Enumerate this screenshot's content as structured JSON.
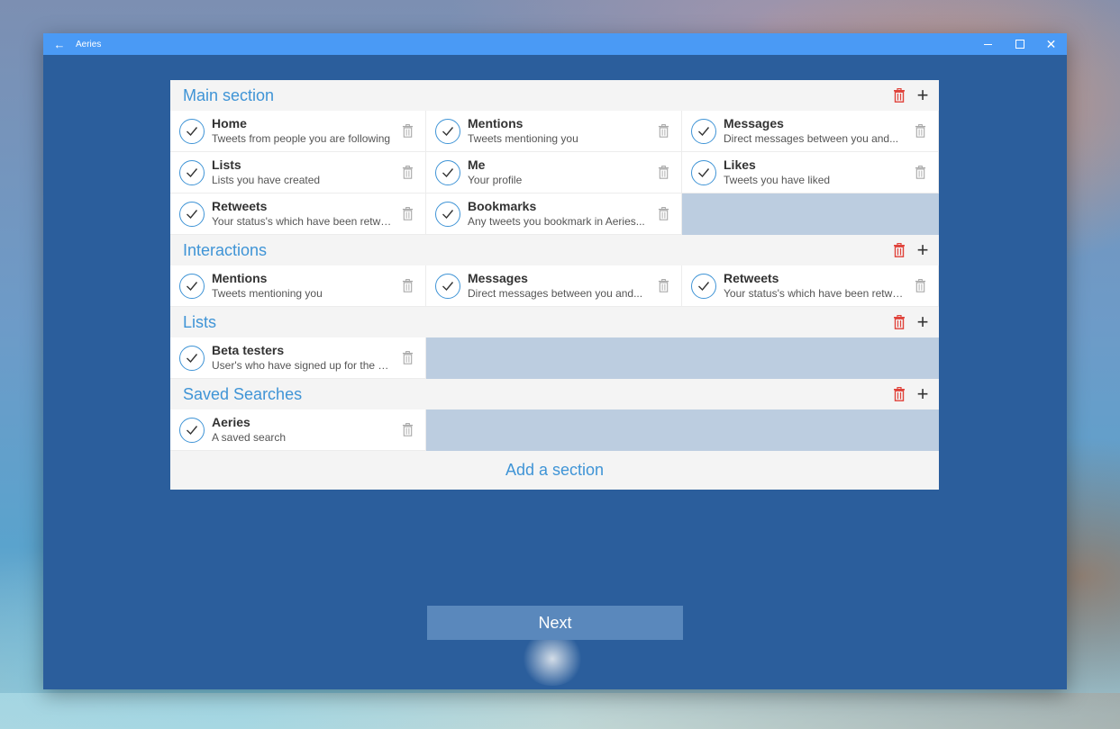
{
  "window": {
    "title": "Aeries"
  },
  "sections": [
    {
      "title": "Main section",
      "items": [
        {
          "title": "Home",
          "subtitle": "Tweets from people you are following"
        },
        {
          "title": "Mentions",
          "subtitle": "Tweets mentioning you"
        },
        {
          "title": "Messages",
          "subtitle": "Direct messages between you and..."
        },
        {
          "title": "Lists",
          "subtitle": "Lists you have created"
        },
        {
          "title": "Me",
          "subtitle": "Your profile"
        },
        {
          "title": "Likes",
          "subtitle": "Tweets you have liked"
        },
        {
          "title": "Retweets",
          "subtitle": "Your status's which have been retwe..."
        },
        {
          "title": "Bookmarks",
          "subtitle": "Any tweets you bookmark in Aeries..."
        }
      ]
    },
    {
      "title": "Interactions",
      "items": [
        {
          "title": "Mentions",
          "subtitle": "Tweets mentioning you"
        },
        {
          "title": "Messages",
          "subtitle": "Direct messages between you and..."
        },
        {
          "title": "Retweets",
          "subtitle": "Your status's which have been retwe..."
        }
      ]
    },
    {
      "title": "Lists",
      "items": [
        {
          "title": "Beta testers",
          "subtitle": "User's who have signed up for the b..."
        }
      ]
    },
    {
      "title": "Saved Searches",
      "items": [
        {
          "title": "Aeries",
          "subtitle": " A saved search"
        }
      ]
    }
  ],
  "add_section_label": "Add a section",
  "next_label": "Next",
  "colors": {
    "accent": "#3f94d6",
    "delete": "#e0433b",
    "window_bg": "#2b5e9c",
    "titlebar": "#4a9af5"
  }
}
